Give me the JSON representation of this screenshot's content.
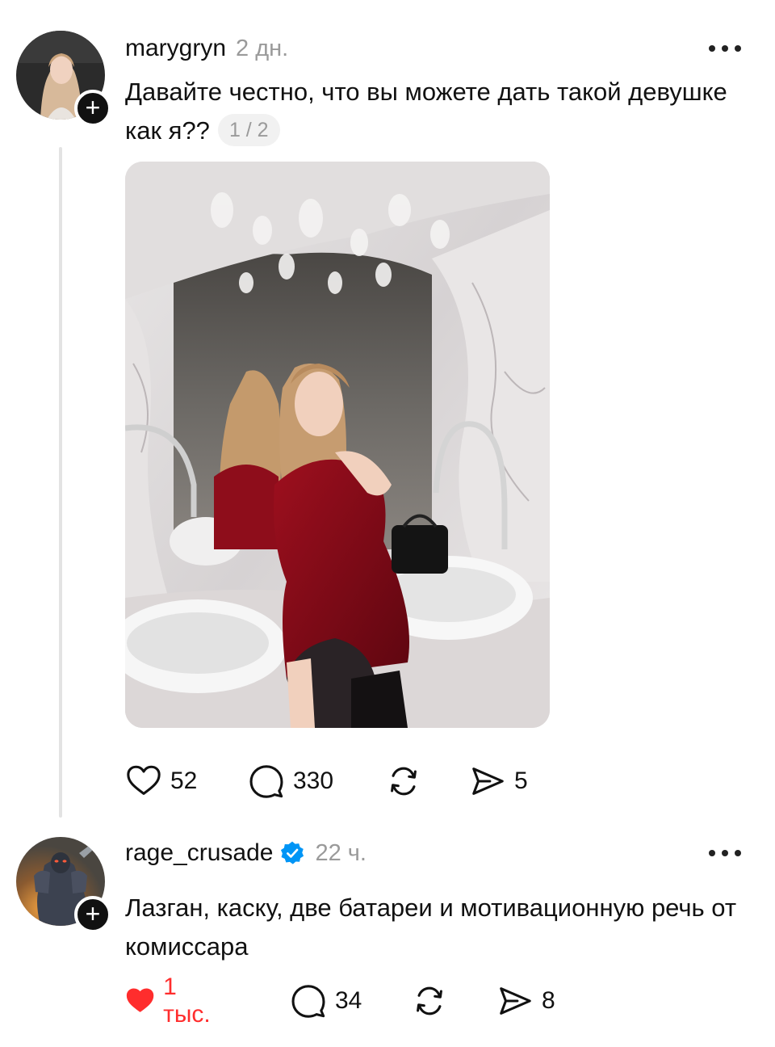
{
  "posts": [
    {
      "username": "marygryn",
      "time": "2 дн.",
      "verified": false,
      "text": "Давайте честно, что вы можете дать такой девушке как я??",
      "media_counter": "1 / 2",
      "actions": {
        "likes": "52",
        "comments": "330",
        "shares": "5",
        "liked": false
      }
    },
    {
      "username": "rage_crusade",
      "time": "22 ч.",
      "verified": true,
      "text": "Лазган, каску, две батареи и мотивационную речь от комиссара",
      "actions": {
        "likes": "1 тыс.",
        "comments": "34",
        "shares": "8",
        "liked": true
      }
    }
  ],
  "icons": {
    "follow": "plus-icon",
    "more": "more-horizontal-icon",
    "like": "heart-icon",
    "comment": "comment-bubble-icon",
    "repost": "repost-icon",
    "share": "send-icon",
    "verified": "verified-badge-icon"
  },
  "colors": {
    "liked": "#ff2d2d",
    "verified": "#0095f6",
    "muted": "#9a9a9a",
    "thread_line": "#e3e3e3"
  }
}
